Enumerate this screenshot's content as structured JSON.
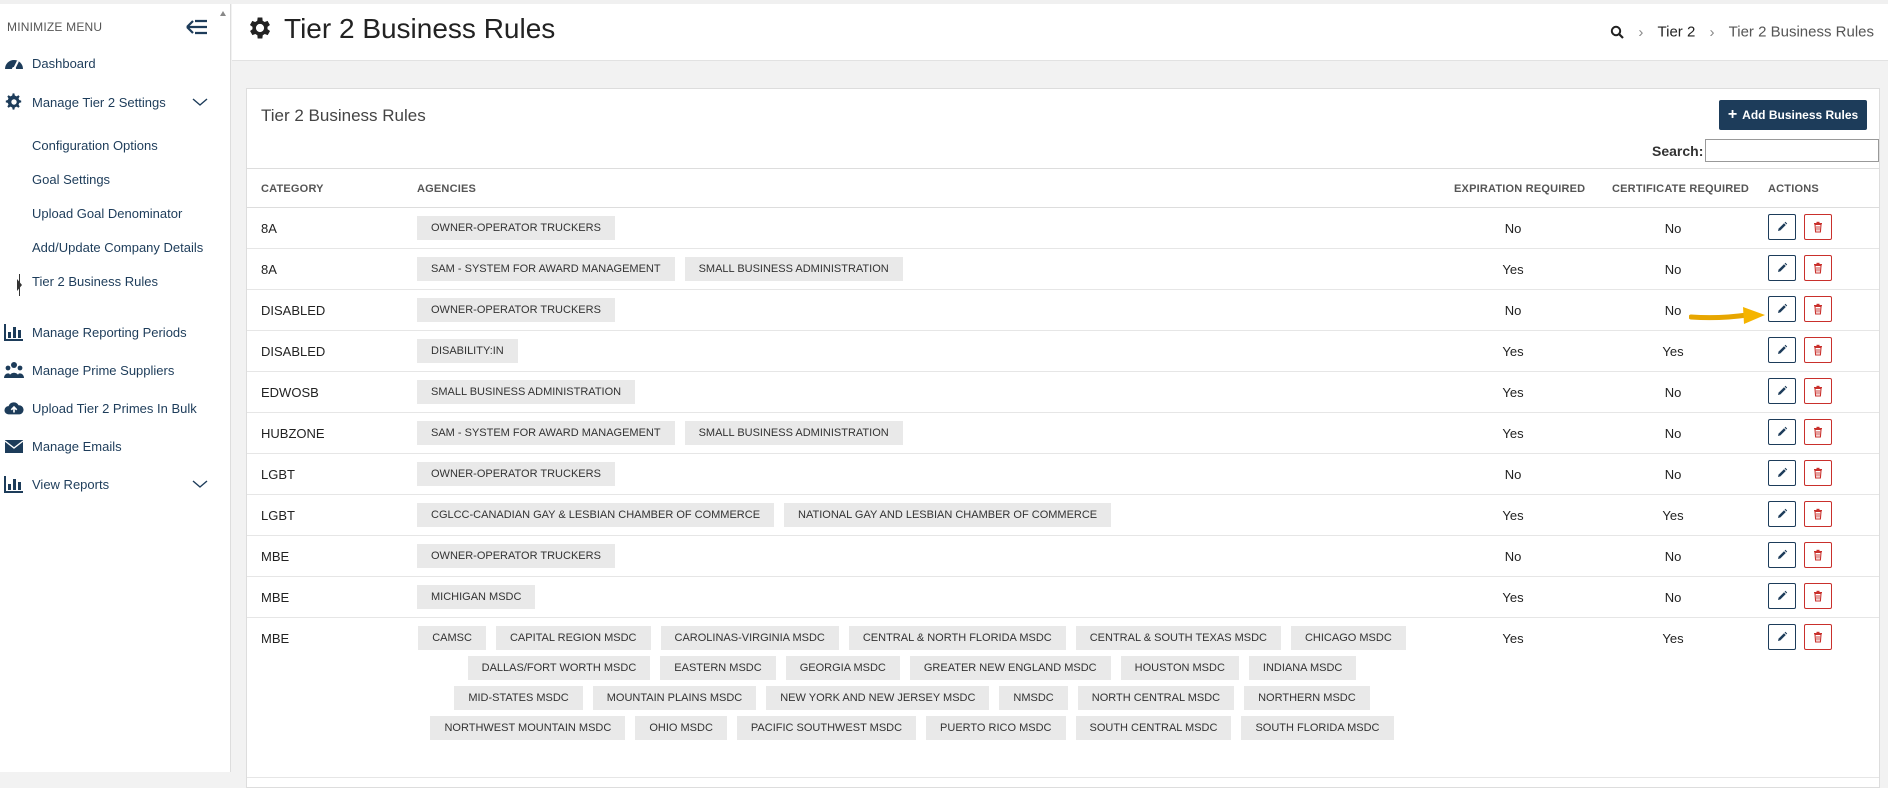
{
  "sidebar": {
    "minimize_label": "MINIMIZE MENU",
    "items": [
      {
        "label": "Dashboard",
        "icon": "speedometer-icon"
      },
      {
        "label": "Manage Tier 2 Settings",
        "icon": "gear-icon",
        "expandable": true
      },
      {
        "label": "Manage Reporting Periods",
        "icon": "bar-chart-icon"
      },
      {
        "label": "Manage Prime Suppliers",
        "icon": "users-icon"
      },
      {
        "label": "Upload Tier 2 Primes In Bulk",
        "icon": "cloud-upload-icon"
      },
      {
        "label": "Manage Emails",
        "icon": "envelope-icon"
      },
      {
        "label": "View Reports",
        "icon": "bar-chart-icon",
        "expandable": true
      }
    ],
    "subitems": [
      {
        "label": "Configuration Options"
      },
      {
        "label": "Goal Settings"
      },
      {
        "label": "Upload Goal Denominator"
      },
      {
        "label": "Add/Update Company Details"
      },
      {
        "label": "Tier 2 Business Rules",
        "active": true
      }
    ]
  },
  "header": {
    "title": "Tier 2 Business Rules",
    "breadcrumb": [
      "Tier 2",
      "Tier 2 Business Rules"
    ]
  },
  "card": {
    "title": "Tier 2 Business Rules",
    "add_button": "Add Business Rules",
    "search_label": "Search:",
    "columns": [
      "CATEGORY",
      "AGENCIES",
      "EXPIRATION REQUIRED",
      "CERTIFICATE REQUIRED",
      "ACTIONS"
    ],
    "rows": [
      {
        "category": "8A",
        "agencies": [
          "OWNER-OPERATOR TRUCKERS"
        ],
        "expiration": "No",
        "certificate": "No"
      },
      {
        "category": "8A",
        "agencies": [
          "SAM - SYSTEM FOR AWARD MANAGEMENT",
          "SMALL BUSINESS ADMINISTRATION"
        ],
        "expiration": "Yes",
        "certificate": "No"
      },
      {
        "category": "DISABLED",
        "agencies": [
          "OWNER-OPERATOR TRUCKERS"
        ],
        "expiration": "No",
        "certificate": "No"
      },
      {
        "category": "DISABLED",
        "agencies": [
          "DISABILITY:IN"
        ],
        "expiration": "Yes",
        "certificate": "Yes"
      },
      {
        "category": "EDWOSB",
        "agencies": [
          "SMALL BUSINESS ADMINISTRATION"
        ],
        "expiration": "Yes",
        "certificate": "No"
      },
      {
        "category": "HUBZONE",
        "agencies": [
          "SAM - SYSTEM FOR AWARD MANAGEMENT",
          "SMALL BUSINESS ADMINISTRATION"
        ],
        "expiration": "Yes",
        "certificate": "No"
      },
      {
        "category": "LGBT",
        "agencies": [
          "OWNER-OPERATOR TRUCKERS"
        ],
        "expiration": "No",
        "certificate": "No"
      },
      {
        "category": "LGBT",
        "agencies": [
          "CGLCC-CANADIAN GAY & LESBIAN CHAMBER OF COMMERCE",
          "NATIONAL GAY AND LESBIAN CHAMBER OF COMMERCE"
        ],
        "expiration": "Yes",
        "certificate": "Yes"
      },
      {
        "category": "MBE",
        "agencies": [
          "OWNER-OPERATOR TRUCKERS"
        ],
        "expiration": "No",
        "certificate": "No"
      },
      {
        "category": "MBE",
        "agencies": [
          "MICHIGAN MSDC"
        ],
        "expiration": "Yes",
        "certificate": "No"
      },
      {
        "category": "MBE",
        "agencies": [
          "CAMSC",
          "CAPITAL REGION MSDC",
          "CAROLINAS-VIRGINIA MSDC",
          "CENTRAL & NORTH FLORIDA MSDC",
          "CENTRAL & SOUTH TEXAS MSDC",
          "CHICAGO MSDC",
          "DALLAS/FORT WORTH MSDC",
          "EASTERN MSDC",
          "GEORGIA MSDC",
          "GREATER NEW ENGLAND MSDC",
          "HOUSTON MSDC",
          "INDIANA MSDC",
          "MID-STATES MSDC",
          "MOUNTAIN PLAINS MSDC",
          "NEW YORK AND NEW JERSEY MSDC",
          "NMSDC",
          "NORTH CENTRAL MSDC",
          "NORTHERN MSDC",
          "NORTHWEST MOUNTAIN MSDC",
          "OHIO MSDC",
          "PACIFIC SOUTHWEST MSDC",
          "PUERTO RICO MSDC",
          "SOUTH CENTRAL MSDC",
          "SOUTH FLORIDA MSDC"
        ],
        "expiration": "Yes",
        "certificate": "Yes"
      }
    ]
  },
  "colors": {
    "primary": "#1d3c5a",
    "danger": "#c9302c",
    "arrow": "#f5b400",
    "tag_bg": "#e9e9e9"
  }
}
